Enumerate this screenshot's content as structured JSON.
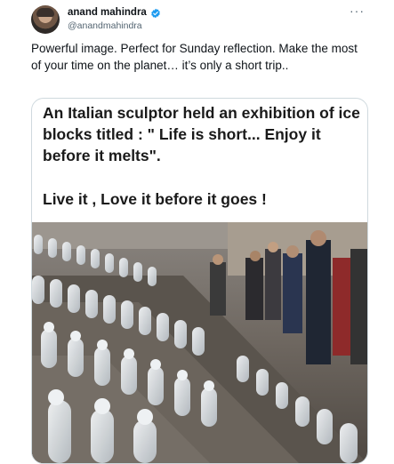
{
  "author": {
    "display_name": "anand mahindra",
    "handle": "@anandmahindra",
    "verified_icon": "verified-badge-icon",
    "verified_color": "#1d9bf0"
  },
  "menu": {
    "more_label": "···"
  },
  "tweet": {
    "text": "Powerful image. Perfect for Sunday reflection. Make the most of your time on the planet… it’s only a short trip.."
  },
  "media": {
    "caption_line1": "An Italian sculptor held an exhibition of ice blocks titled : \" Life is short... Enjoy it before it melts\".",
    "caption_line2": "Live it , Love it before it goes !"
  }
}
